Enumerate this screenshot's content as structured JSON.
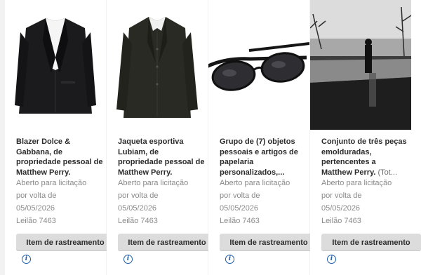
{
  "cards": [
    {
      "title": "Blazer Dolce & Gabbana, de propriedade pessoal de Matthew Perry.",
      "title_extra": "",
      "status_line1": "Aberto para licitação",
      "status_line2": "por volta de",
      "date": "05/05/2026",
      "auction": "Leilão 7463",
      "button": "Item de rastreamento",
      "image": "black-blazer-photo"
    },
    {
      "title": "Jaqueta esportiva Lubiam, de propriedade pessoal de Matthew Perry.",
      "title_extra": "",
      "status_line1": "Aberto para licitação",
      "status_line2": "por volta de",
      "date": "05/05/2026",
      "auction": "Leilão 7463",
      "button": "Item de rastreamento",
      "image": "sport-jacket-photo"
    },
    {
      "title": "Grupo de (7) objetos pessoais e artigos de papelaria personalizados,...",
      "title_extra": "",
      "status_line1": "Aberto para licitação",
      "status_line2": "por volta de",
      "date": "05/05/2026",
      "auction": "Leilão 7463",
      "button": "Item de rastreamento",
      "image": "sunglasses-photo"
    },
    {
      "title": "Conjunto de três peças emolduradas, pertencentes a Matthew Perry.",
      "title_extra": " (Tot...",
      "status_line1": "Aberto para licitação",
      "status_line2": "por volta de",
      "date": "05/05/2026",
      "auction": "Leilão 7463",
      "button": "Item de rastreamento",
      "image": "framed-photograph"
    }
  ],
  "colors": {
    "info_icon": "#1f5ea8",
    "button_bg": "#dcdcdc",
    "page_bg": "#f2f2f2"
  }
}
